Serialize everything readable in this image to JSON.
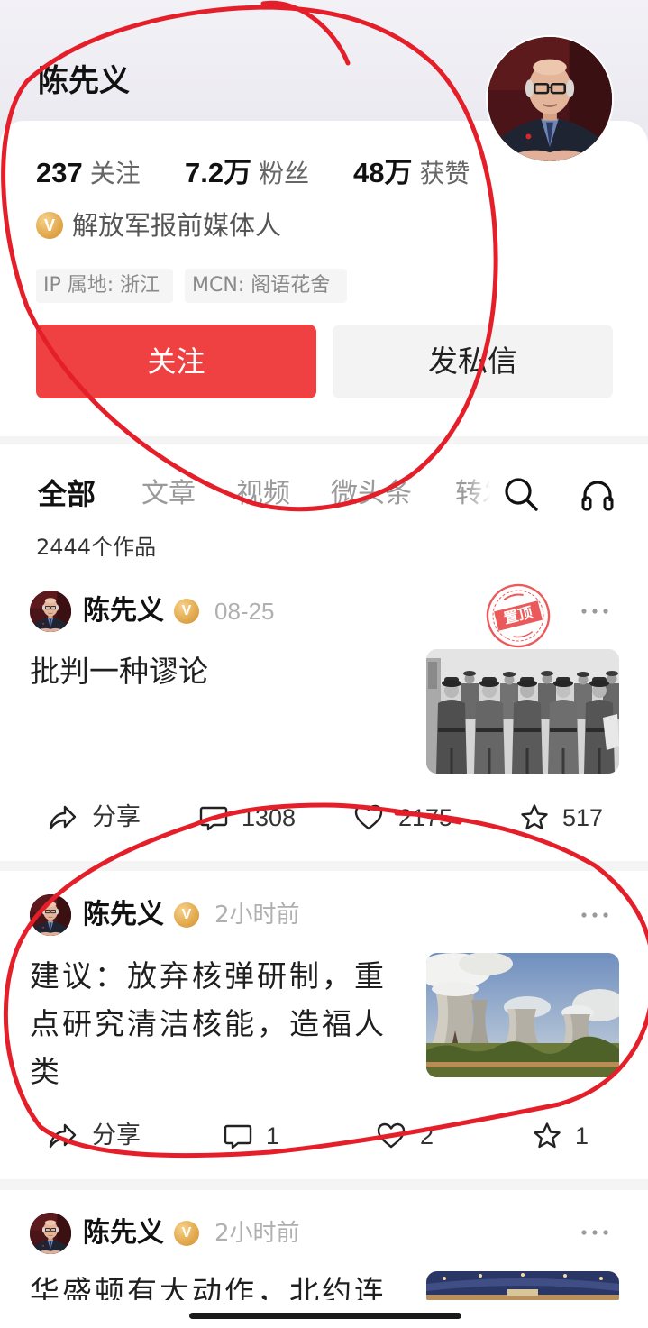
{
  "profile": {
    "name": "陈先义",
    "stats": [
      {
        "value": "237",
        "label": "关注"
      },
      {
        "value": "7.2万",
        "label": "粉丝"
      },
      {
        "value": "48万",
        "label": "获赞"
      }
    ],
    "verified_badge": "V",
    "verified_text": "解放军报前媒体人",
    "tags": [
      "IP 属地: 浙江",
      "MCN: 阁语花舍"
    ],
    "follow_label": "关注",
    "message_label": "发私信"
  },
  "tabs": [
    {
      "label": "全部",
      "active": true
    },
    {
      "label": "文章",
      "active": false
    },
    {
      "label": "视频",
      "active": false
    },
    {
      "label": "微头条",
      "active": false
    },
    {
      "label": "转发",
      "active": false
    }
  ],
  "works_count": "2444个作品",
  "posts": [
    {
      "author": "陈先义",
      "time": "08-25",
      "pinned_label": "置顶",
      "title": "批判一种谬论",
      "share_label": "分享",
      "comments": "1308",
      "likes": "2175",
      "favorites": "517"
    },
    {
      "author": "陈先义",
      "time": "2小时前",
      "title": "建议：放弃核弹研制，重点研究清洁核能，造福人类",
      "share_label": "分享",
      "comments": "1",
      "likes": "2",
      "favorites": "1"
    },
    {
      "author": "陈先义",
      "time": "2小时前",
      "title": "华盛顿有大动作，北约连"
    }
  ],
  "icons": {
    "search": "search-icon",
    "audio": "headphones-icon",
    "more": "more-icon",
    "verified": "verified-icon",
    "share": "share-icon",
    "comment": "comment-icon",
    "like": "heart-icon",
    "favorite": "star-icon"
  },
  "colors": {
    "brand_red": "#f04142",
    "verified_gold": "#e2a84c",
    "stamp_red": "#e9494a",
    "annotation_red": "#e41f2a"
  }
}
